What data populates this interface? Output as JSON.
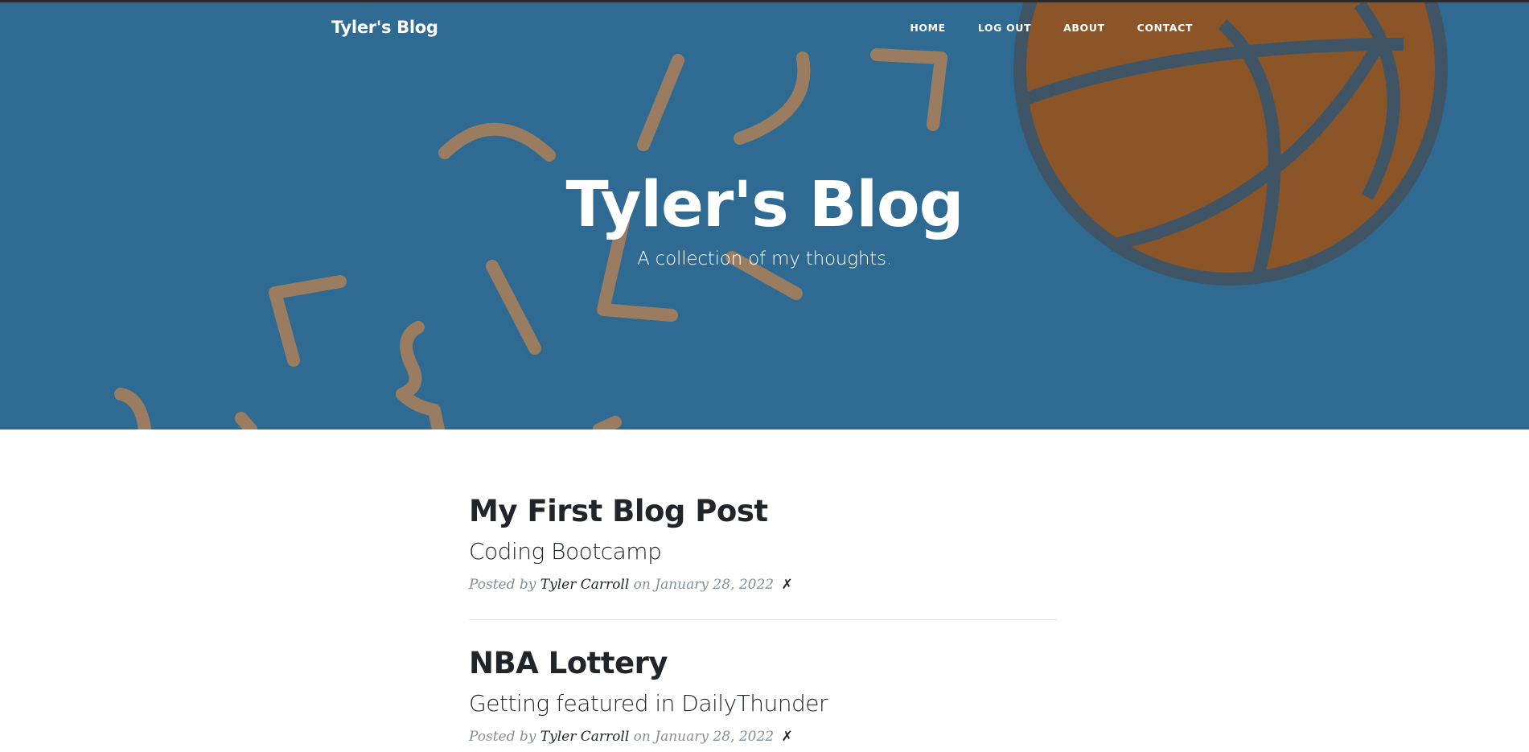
{
  "brand": "Tyler's Blog",
  "nav": {
    "home": "HOME",
    "logout": "LOG OUT",
    "about": "ABOUT",
    "contact": "CONTACT"
  },
  "hero": {
    "title": "Tyler's Blog",
    "subtitle": "A collection of my thoughts."
  },
  "posts": [
    {
      "title": "My First Blog Post",
      "subtitle": "Coding Bootcamp",
      "posted_by": "Posted by",
      "author": "Tyler Carroll",
      "on_date": "on January 28, 2022",
      "delete": "✗"
    },
    {
      "title": "NBA Lottery",
      "subtitle": "Getting featured in DailyThunder",
      "posted_by": "Posted by",
      "author": "Tyler Carroll",
      "on_date": "on January 28, 2022",
      "delete": "✗"
    }
  ],
  "colors": {
    "header_bg": "#2e6a91",
    "ball": "#8c5527",
    "ball_lines": "#3f5566",
    "confetti": "#a07e5e",
    "text_dark": "#212529",
    "meta_gray": "#868e96"
  },
  "icons": {
    "basketball": "basketball-icon"
  }
}
